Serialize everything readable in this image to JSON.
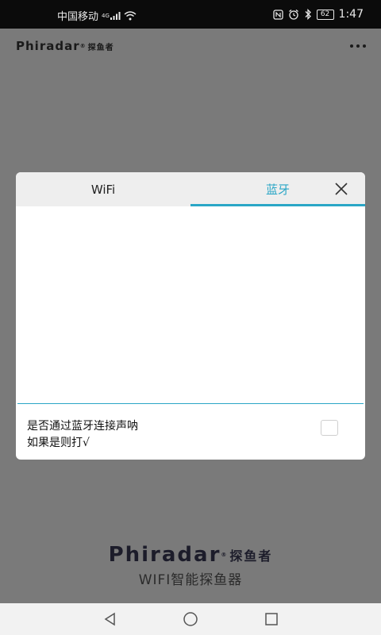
{
  "status_bar": {
    "carrier": "中国移动",
    "network": "4G",
    "battery": "62",
    "time": "1:47"
  },
  "header": {
    "logo": "Phiradar",
    "logo_cn": "探鱼者",
    "menu_icon": "more-horizontal-icon"
  },
  "dialog": {
    "tabs": [
      {
        "label": "WiFi",
        "selected": false
      },
      {
        "label": "蓝牙",
        "selected": true
      }
    ],
    "close_icon": "close-icon",
    "bt_option_line1": "是否通过蓝牙连接声呐",
    "bt_option_line2": "如果是则打√",
    "bt_checked": false,
    "accent_color": "#2aa6c6"
  },
  "footer": {
    "logo": "Phiradar",
    "logo_cn": "探鱼者",
    "tagline": "WIFI智能探鱼器"
  },
  "nav_bar": {
    "back_icon": "back-triangle-icon",
    "home_icon": "home-circle-icon",
    "recent_icon": "recent-square-icon"
  }
}
